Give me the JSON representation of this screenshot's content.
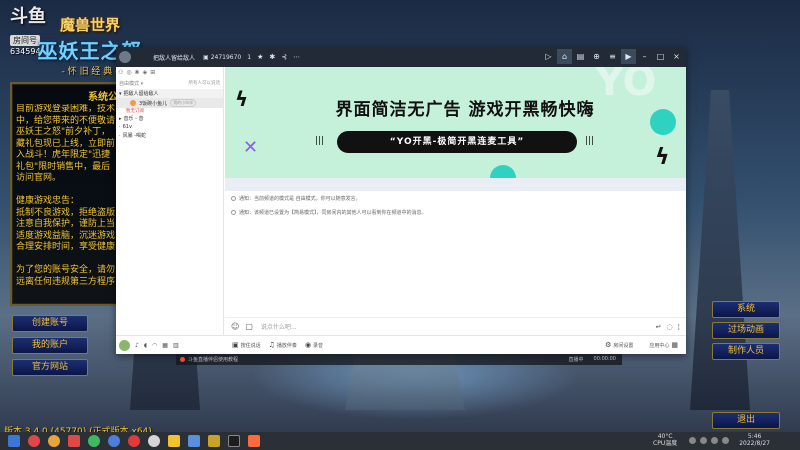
{
  "stream": {
    "logo_text": "斗鱼",
    "room_label": "房间号",
    "room_id": "634594"
  },
  "game": {
    "logo_line1": "魔兽世界",
    "logo_line2": "巫妖王之怒",
    "logo_line3": "- 怀 旧 经 典 -",
    "announcement_title": "系统公",
    "announcement_body": "目前游戏登录困难，技术\n中，给您带来的不便敬请\n巫妖王之怒\"前夕补丁，\n藏礼包现已上线，立即前\n入战斗！虎年限定\"迅捷\n礼包\"限时销售中，最后\n访问官网。\n\n健康游戏忠告：\n抵制不良游戏，拒绝盗版\n注意自我保护，谨防上当\n适度游戏益脑，沉迷游戏\n合理安排时间，享受健康\n\n为了您的账号安全，请勿\n远离任何违规第三方程序",
    "left_buttons": [
      "创建账号",
      "我的账户",
      "官方网站"
    ],
    "right_buttons": [
      "系统",
      "过场动画",
      "制作人员",
      "退出"
    ],
    "version": "版本 3.4.0 (45770) (正式版本 x64)"
  },
  "client": {
    "room_name": "把敌人留给敌人",
    "room_id": "24719670",
    "member_count": "1",
    "sidebar": {
      "mode": "自由模式",
      "hint": "所有人可以说话",
      "channel_main": "把敌人留给敌人",
      "channel_user": "3饭碗小鱼儿",
      "user_tag": "我的小伙伴",
      "red_note": "暂无订阅",
      "channel_2": "音乐 - 音",
      "channel_3": "61v",
      "channel_4": "风暴 -喝蛇"
    },
    "banner": {
      "headline": "界面简洁无广告  游戏开黑畅快嗨",
      "tagline": "“YO开黑-极简开黑连麦工具”",
      "watermark": "YO"
    },
    "messages": [
      "通知：当前频道的模式是 自由模式，你可以随意发言。",
      "通知：该频道已设置为【简易模式】，同房间内的其他人可以看到你在频道中的消息。"
    ],
    "composer_placeholder": "说点什么吧...",
    "bottombar": {
      "mic_label": "按住说话",
      "listen_label": "播放伴奏",
      "record_label": "录音",
      "settings_label": "房间设置",
      "apply_label": "应用中心"
    }
  },
  "status_strip": {
    "left": "斗鱼直播伴侣使用教程",
    "right1": "直播中",
    "right2": "00:00:00"
  },
  "taskbar": {
    "weather_temp": "40°C",
    "weather_label": "CPU温度",
    "time": "5:46",
    "date": "2022/8/27"
  }
}
